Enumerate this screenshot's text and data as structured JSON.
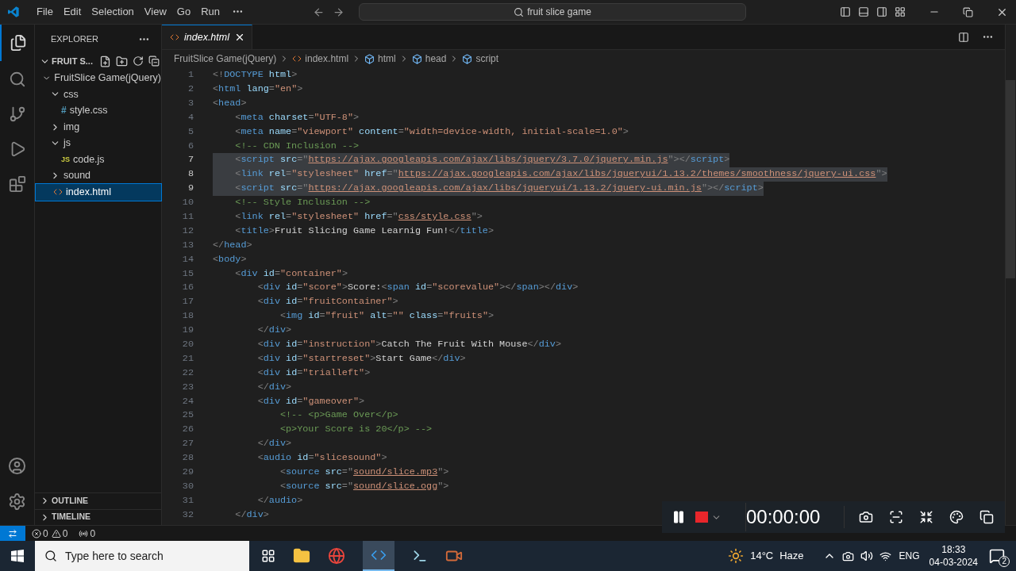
{
  "menu": [
    "File",
    "Edit",
    "Selection",
    "View",
    "Go",
    "Run"
  ],
  "search": {
    "value": "fruit slice game"
  },
  "sidebar": {
    "title": "EXPLORER",
    "section": "FRUIT S...",
    "tree": [
      {
        "label": "FruitSlice Game(jQuery)",
        "kind": "folder",
        "expanded": true,
        "selected": false,
        "children": [
          {
            "label": "css",
            "kind": "folder",
            "expanded": true,
            "selected": false,
            "children": [
              {
                "label": "style.css",
                "kind": "css",
                "badge": "#",
                "selected": false
              }
            ]
          },
          {
            "label": "img",
            "kind": "folder",
            "expanded": false,
            "selected": false
          },
          {
            "label": "js",
            "kind": "folder",
            "expanded": true,
            "selected": false,
            "children": [
              {
                "label": "code.js",
                "kind": "js",
                "badge": "JS",
                "selected": false
              }
            ]
          },
          {
            "label": "sound",
            "kind": "folder",
            "expanded": false,
            "selected": false
          },
          {
            "label": "index.html",
            "kind": "html",
            "selected": true
          }
        ]
      }
    ],
    "panels": [
      {
        "label": "OUTLINE",
        "expanded": false
      },
      {
        "label": "TIMELINE",
        "expanded": false
      }
    ]
  },
  "tabs": [
    {
      "label": "index.html",
      "selected": true
    }
  ],
  "breadcrumbs": [
    {
      "label": "FruitSlice Game(jQuery)",
      "kind": "folder"
    },
    {
      "label": "index.html",
      "kind": "html"
    },
    {
      "label": "html",
      "kind": "element"
    },
    {
      "label": "head",
      "kind": "element"
    },
    {
      "label": "script",
      "kind": "element"
    }
  ],
  "code": [
    {
      "number": "1",
      "selected": false,
      "tokens": [
        {
          "kind": "p",
          "text": "<!"
        },
        {
          "kind": "tag",
          "text": "DOCTYPE"
        },
        {
          "kind": "attr",
          "text": " html"
        },
        {
          "kind": "p",
          "text": ">"
        }
      ]
    },
    {
      "number": "2",
      "selected": false,
      "tokens": [
        {
          "kind": "p",
          "text": "<"
        },
        {
          "kind": "tag",
          "text": "html"
        },
        {
          "kind": "attr",
          "text": " lang"
        },
        {
          "kind": "p",
          "text": "="
        },
        {
          "kind": "str",
          "text": "\"en\""
        },
        {
          "kind": "p",
          "text": ">"
        }
      ]
    },
    {
      "number": "3",
      "selected": false,
      "tokens": [
        {
          "kind": "p",
          "text": "<"
        },
        {
          "kind": "tag",
          "text": "head"
        },
        {
          "kind": "p",
          "text": ">"
        }
      ]
    },
    {
      "number": "4",
      "selected": false,
      "tokens": [
        {
          "kind": "p",
          "text": "    <"
        },
        {
          "kind": "tag",
          "text": "meta"
        },
        {
          "kind": "attr",
          "text": " charset"
        },
        {
          "kind": "p",
          "text": "="
        },
        {
          "kind": "str",
          "text": "\"UTF-8\""
        },
        {
          "kind": "p",
          "text": ">"
        }
      ]
    },
    {
      "number": "5",
      "selected": false,
      "tokens": [
        {
          "kind": "p",
          "text": "    <"
        },
        {
          "kind": "tag",
          "text": "meta"
        },
        {
          "kind": "attr",
          "text": " name"
        },
        {
          "kind": "p",
          "text": "="
        },
        {
          "kind": "str",
          "text": "\"viewport\""
        },
        {
          "kind": "attr",
          "text": " content"
        },
        {
          "kind": "p",
          "text": "="
        },
        {
          "kind": "str",
          "text": "\"width=device-width, initial-scale=1.0\""
        },
        {
          "kind": "p",
          "text": ">"
        }
      ]
    },
    {
      "number": "6",
      "selected": false,
      "tokens": [
        {
          "kind": "comment",
          "text": "    <!-- CDN Inclusion -->"
        }
      ]
    },
    {
      "number": "7",
      "selected": true,
      "tokens": [
        {
          "kind": "p",
          "text": "    <"
        },
        {
          "kind": "tag",
          "text": "script"
        },
        {
          "kind": "attr",
          "text": " src"
        },
        {
          "kind": "p",
          "text": "=\""
        },
        {
          "kind": "link",
          "text": "https://ajax.googleapis.com/ajax/libs/jquery/3.7.0/jquery.min.js"
        },
        {
          "kind": "p",
          "text": "\"></"
        },
        {
          "kind": "tag",
          "text": "script"
        },
        {
          "kind": "p",
          "text": ">"
        }
      ]
    },
    {
      "number": "8",
      "selected": true,
      "tokens": [
        {
          "kind": "p",
          "text": "    <"
        },
        {
          "kind": "tag",
          "text": "link"
        },
        {
          "kind": "attr",
          "text": " rel"
        },
        {
          "kind": "p",
          "text": "="
        },
        {
          "kind": "str",
          "text": "\"stylesheet\""
        },
        {
          "kind": "attr",
          "text": " href"
        },
        {
          "kind": "p",
          "text": "=\""
        },
        {
          "kind": "link",
          "text": "https://ajax.googleapis.com/ajax/libs/jqueryui/1.13.2/themes/smoothness/jquery-ui.css"
        },
        {
          "kind": "p",
          "text": "\">"
        }
      ]
    },
    {
      "number": "9",
      "selected": true,
      "tokens": [
        {
          "kind": "p",
          "text": "    <"
        },
        {
          "kind": "tag",
          "text": "script"
        },
        {
          "kind": "attr",
          "text": " src"
        },
        {
          "kind": "p",
          "text": "=\""
        },
        {
          "kind": "link",
          "text": "https://ajax.googleapis.com/ajax/libs/jqueryui/1.13.2/jquery-ui.min.js"
        },
        {
          "kind": "p",
          "text": "\"></"
        },
        {
          "kind": "tag",
          "text": "script"
        },
        {
          "kind": "p",
          "text": ">"
        }
      ]
    },
    {
      "number": "10",
      "selected": false,
      "tokens": [
        {
          "kind": "comment",
          "text": "    <!-- Style Inclusion -->"
        }
      ]
    },
    {
      "number": "11",
      "selected": false,
      "tokens": [
        {
          "kind": "p",
          "text": "    <"
        },
        {
          "kind": "tag",
          "text": "link"
        },
        {
          "kind": "attr",
          "text": " rel"
        },
        {
          "kind": "p",
          "text": "="
        },
        {
          "kind": "str",
          "text": "\"stylesheet\""
        },
        {
          "kind": "attr",
          "text": " href"
        },
        {
          "kind": "p",
          "text": "=\""
        },
        {
          "kind": "link",
          "text": "css/style.css"
        },
        {
          "kind": "p",
          "text": "\">"
        }
      ]
    },
    {
      "number": "12",
      "selected": false,
      "tokens": [
        {
          "kind": "p",
          "text": "    <"
        },
        {
          "kind": "tag",
          "text": "title"
        },
        {
          "kind": "p",
          "text": ">"
        },
        {
          "kind": "text",
          "text": "Fruit Slicing Game Learnig Fun!"
        },
        {
          "kind": "p",
          "text": "</"
        },
        {
          "kind": "tag",
          "text": "title"
        },
        {
          "kind": "p",
          "text": ">"
        }
      ]
    },
    {
      "number": "13",
      "selected": false,
      "tokens": [
        {
          "kind": "p",
          "text": "</"
        },
        {
          "kind": "tag",
          "text": "head"
        },
        {
          "kind": "p",
          "text": ">"
        }
      ]
    },
    {
      "number": "14",
      "selected": false,
      "tokens": [
        {
          "kind": "p",
          "text": "<"
        },
        {
          "kind": "tag",
          "text": "body"
        },
        {
          "kind": "p",
          "text": ">"
        }
      ]
    },
    {
      "number": "15",
      "selected": false,
      "tokens": [
        {
          "kind": "p",
          "text": "    <"
        },
        {
          "kind": "tag",
          "text": "div"
        },
        {
          "kind": "attr",
          "text": " id"
        },
        {
          "kind": "p",
          "text": "="
        },
        {
          "kind": "str",
          "text": "\"container\""
        },
        {
          "kind": "p",
          "text": ">"
        }
      ]
    },
    {
      "number": "16",
      "selected": false,
      "tokens": [
        {
          "kind": "p",
          "text": "        <"
        },
        {
          "kind": "tag",
          "text": "div"
        },
        {
          "kind": "attr",
          "text": " id"
        },
        {
          "kind": "p",
          "text": "="
        },
        {
          "kind": "str",
          "text": "\"score\""
        },
        {
          "kind": "p",
          "text": ">"
        },
        {
          "kind": "text",
          "text": "Score:"
        },
        {
          "kind": "p",
          "text": "<"
        },
        {
          "kind": "tag",
          "text": "span"
        },
        {
          "kind": "attr",
          "text": " id"
        },
        {
          "kind": "p",
          "text": "="
        },
        {
          "kind": "str",
          "text": "\"scorevalue\""
        },
        {
          "kind": "p",
          "text": "></"
        },
        {
          "kind": "tag",
          "text": "span"
        },
        {
          "kind": "p",
          "text": "></"
        },
        {
          "kind": "tag",
          "text": "div"
        },
        {
          "kind": "p",
          "text": ">"
        }
      ]
    },
    {
      "number": "17",
      "selected": false,
      "tokens": [
        {
          "kind": "p",
          "text": "        <"
        },
        {
          "kind": "tag",
          "text": "div"
        },
        {
          "kind": "attr",
          "text": " id"
        },
        {
          "kind": "p",
          "text": "="
        },
        {
          "kind": "str",
          "text": "\"fruitContainer\""
        },
        {
          "kind": "p",
          "text": ">"
        }
      ]
    },
    {
      "number": "18",
      "selected": false,
      "tokens": [
        {
          "kind": "p",
          "text": "            <"
        },
        {
          "kind": "tag",
          "text": "img"
        },
        {
          "kind": "attr",
          "text": " id"
        },
        {
          "kind": "p",
          "text": "="
        },
        {
          "kind": "str",
          "text": "\"fruit\""
        },
        {
          "kind": "attr",
          "text": " alt"
        },
        {
          "kind": "p",
          "text": "="
        },
        {
          "kind": "str",
          "text": "\"\""
        },
        {
          "kind": "attr",
          "text": " class"
        },
        {
          "kind": "p",
          "text": "="
        },
        {
          "kind": "str",
          "text": "\"fruits\""
        },
        {
          "kind": "p",
          "text": ">"
        }
      ]
    },
    {
      "number": "19",
      "selected": false,
      "tokens": [
        {
          "kind": "p",
          "text": "        </"
        },
        {
          "kind": "tag",
          "text": "div"
        },
        {
          "kind": "p",
          "text": ">"
        }
      ]
    },
    {
      "number": "20",
      "selected": false,
      "tokens": [
        {
          "kind": "p",
          "text": "        <"
        },
        {
          "kind": "tag",
          "text": "div"
        },
        {
          "kind": "attr",
          "text": " id"
        },
        {
          "kind": "p",
          "text": "="
        },
        {
          "kind": "str",
          "text": "\"instruction\""
        },
        {
          "kind": "p",
          "text": ">"
        },
        {
          "kind": "text",
          "text": "Catch The Fruit With Mouse"
        },
        {
          "kind": "p",
          "text": "</"
        },
        {
          "kind": "tag",
          "text": "div"
        },
        {
          "kind": "p",
          "text": ">"
        }
      ]
    },
    {
      "number": "21",
      "selected": false,
      "tokens": [
        {
          "kind": "p",
          "text": "        <"
        },
        {
          "kind": "tag",
          "text": "div"
        },
        {
          "kind": "attr",
          "text": " id"
        },
        {
          "kind": "p",
          "text": "="
        },
        {
          "kind": "str",
          "text": "\"startreset\""
        },
        {
          "kind": "p",
          "text": ">"
        },
        {
          "kind": "text",
          "text": "Start Game"
        },
        {
          "kind": "p",
          "text": "</"
        },
        {
          "kind": "tag",
          "text": "div"
        },
        {
          "kind": "p",
          "text": ">"
        }
      ]
    },
    {
      "number": "22",
      "selected": false,
      "tokens": [
        {
          "kind": "p",
          "text": "        <"
        },
        {
          "kind": "tag",
          "text": "div"
        },
        {
          "kind": "attr",
          "text": " id"
        },
        {
          "kind": "p",
          "text": "="
        },
        {
          "kind": "str",
          "text": "\"trialleft\""
        },
        {
          "kind": "p",
          "text": ">"
        }
      ]
    },
    {
      "number": "23",
      "selected": false,
      "tokens": [
        {
          "kind": "p",
          "text": "        </"
        },
        {
          "kind": "tag",
          "text": "div"
        },
        {
          "kind": "p",
          "text": ">"
        }
      ]
    },
    {
      "number": "24",
      "selected": false,
      "tokens": [
        {
          "kind": "p",
          "text": "        <"
        },
        {
          "kind": "tag",
          "text": "div"
        },
        {
          "kind": "attr",
          "text": " id"
        },
        {
          "kind": "p",
          "text": "="
        },
        {
          "kind": "str",
          "text": "\"gameover\""
        },
        {
          "kind": "p",
          "text": ">"
        }
      ]
    },
    {
      "number": "25",
      "selected": false,
      "tokens": [
        {
          "kind": "comment",
          "text": "            <!-- <p>Game Over</p>"
        }
      ]
    },
    {
      "number": "26",
      "selected": false,
      "tokens": [
        {
          "kind": "comment",
          "text": "            <p>Your Score is 20</p> -->"
        }
      ]
    },
    {
      "number": "27",
      "selected": false,
      "tokens": [
        {
          "kind": "p",
          "text": "        </"
        },
        {
          "kind": "tag",
          "text": "div"
        },
        {
          "kind": "p",
          "text": ">"
        }
      ]
    },
    {
      "number": "28",
      "selected": false,
      "tokens": [
        {
          "kind": "p",
          "text": "        <"
        },
        {
          "kind": "tag",
          "text": "audio"
        },
        {
          "kind": "attr",
          "text": " id"
        },
        {
          "kind": "p",
          "text": "="
        },
        {
          "kind": "str",
          "text": "\"slicesound\""
        },
        {
          "kind": "p",
          "text": ">"
        }
      ]
    },
    {
      "number": "29",
      "selected": false,
      "tokens": [
        {
          "kind": "p",
          "text": "            <"
        },
        {
          "kind": "tag",
          "text": "source"
        },
        {
          "kind": "attr",
          "text": " src"
        },
        {
          "kind": "p",
          "text": "=\""
        },
        {
          "kind": "link",
          "text": "sound/slice.mp3"
        },
        {
          "kind": "p",
          "text": "\">"
        }
      ]
    },
    {
      "number": "30",
      "selected": false,
      "tokens": [
        {
          "kind": "p",
          "text": "            <"
        },
        {
          "kind": "tag",
          "text": "source"
        },
        {
          "kind": "attr",
          "text": " src"
        },
        {
          "kind": "p",
          "text": "=\""
        },
        {
          "kind": "link",
          "text": "sound/slice.ogg"
        },
        {
          "kind": "p",
          "text": "\">"
        }
      ]
    },
    {
      "number": "31",
      "selected": false,
      "tokens": [
        {
          "kind": "p",
          "text": "        </"
        },
        {
          "kind": "tag",
          "text": "audio"
        },
        {
          "kind": "p",
          "text": ">"
        }
      ]
    },
    {
      "number": "32",
      "selected": false,
      "tokens": [
        {
          "kind": "p",
          "text": "    </"
        },
        {
          "kind": "tag",
          "text": "div"
        },
        {
          "kind": "p",
          "text": ">"
        }
      ]
    }
  ],
  "status": {
    "errors": "0",
    "warnings": "0",
    "ports": "0"
  },
  "recorder": {
    "timer": "00:00:00",
    "recording": true
  },
  "taskbar": {
    "search_placeholder": "Type here to search",
    "temperature": "14°C",
    "weather": "Haze",
    "language": "ENG",
    "time": "18:33",
    "date": "04-03-2024",
    "notifications": "2"
  }
}
